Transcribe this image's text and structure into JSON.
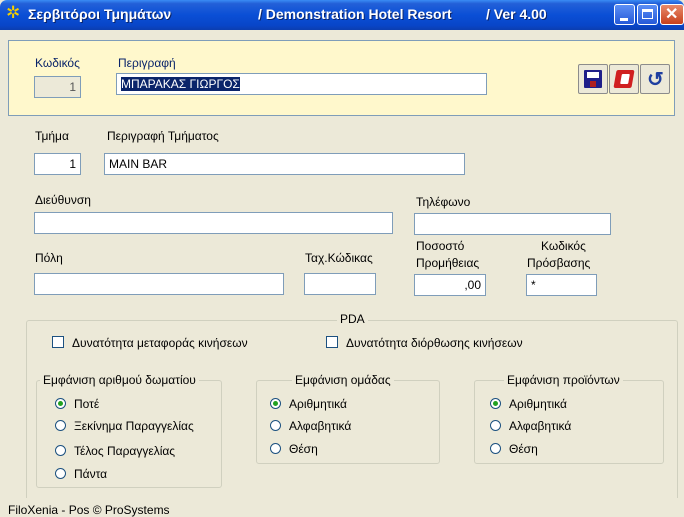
{
  "window": {
    "title": "Σερβιτόροι Τμημάτων",
    "hotel": "/ Demonstration Hotel Resort",
    "version": "/ Ver  4.00"
  },
  "top": {
    "code_label": "Κωδικός",
    "code_value": "1",
    "desc_label": "Περιγραφή",
    "desc_value": "ΜΠΑΡΑΚΑΣ ΓΙΩΡΓΟΣ"
  },
  "toolbar": {
    "save_icon": "floppy-disk-icon",
    "delete_icon": "eraser-icon",
    "undo_icon": "undo-icon"
  },
  "form": {
    "dept_label": "Τμήμα",
    "dept_value": "1",
    "dept_desc_label": "Περιγραφή Τμήματος",
    "dept_desc_value": "MAIN BAR",
    "address_label": "Διεύθυνση",
    "address_value": "",
    "phone_label": "Τηλέφωνο",
    "phone_value": "",
    "city_label": "Πόλη",
    "city_value": "",
    "zip_label": "Ταχ.Κώδικας",
    "zip_value": "",
    "commission_label_1": "Ποσοστό",
    "commission_label_2": "Προμήθειας",
    "commission_value": ",00",
    "access_label_1": "Κωδικός",
    "access_label_2": "Πρόσβασης",
    "access_value": "*"
  },
  "pda": {
    "title": "PDA",
    "check_transfer": "Δυνατότητα μεταφοράς κινήσεων",
    "check_correct": "Δυνατότητα διόρθωσης κινήσεων",
    "room_group": {
      "title": "Εμφάνιση αριθμού δωματίου",
      "options": [
        "Ποτέ",
        "Ξεκίνημα Παραγγελίας",
        "Τέλος Παραγγελίας",
        "Πάντα"
      ],
      "selected": "Ποτέ"
    },
    "group_group": {
      "title": "Εμφάνιση ομάδας",
      "options": [
        "Αριθμητικά",
        "Αλφαβητικά",
        "Θέση"
      ],
      "selected": "Αριθμητικά"
    },
    "product_group": {
      "title": "Εμφάνιση προϊόντων",
      "options": [
        "Αριθμητικά",
        "Αλφαβητικά",
        "Θέση"
      ],
      "selected": "Αριθμητικά"
    }
  },
  "status": "FiloXenia - Pos  © ProSystems",
  "colors": {
    "titlebar": "#0A4FD6",
    "panel": "#FFF8CC",
    "selection": "#0A246A",
    "radio_dot": "#21A121"
  }
}
